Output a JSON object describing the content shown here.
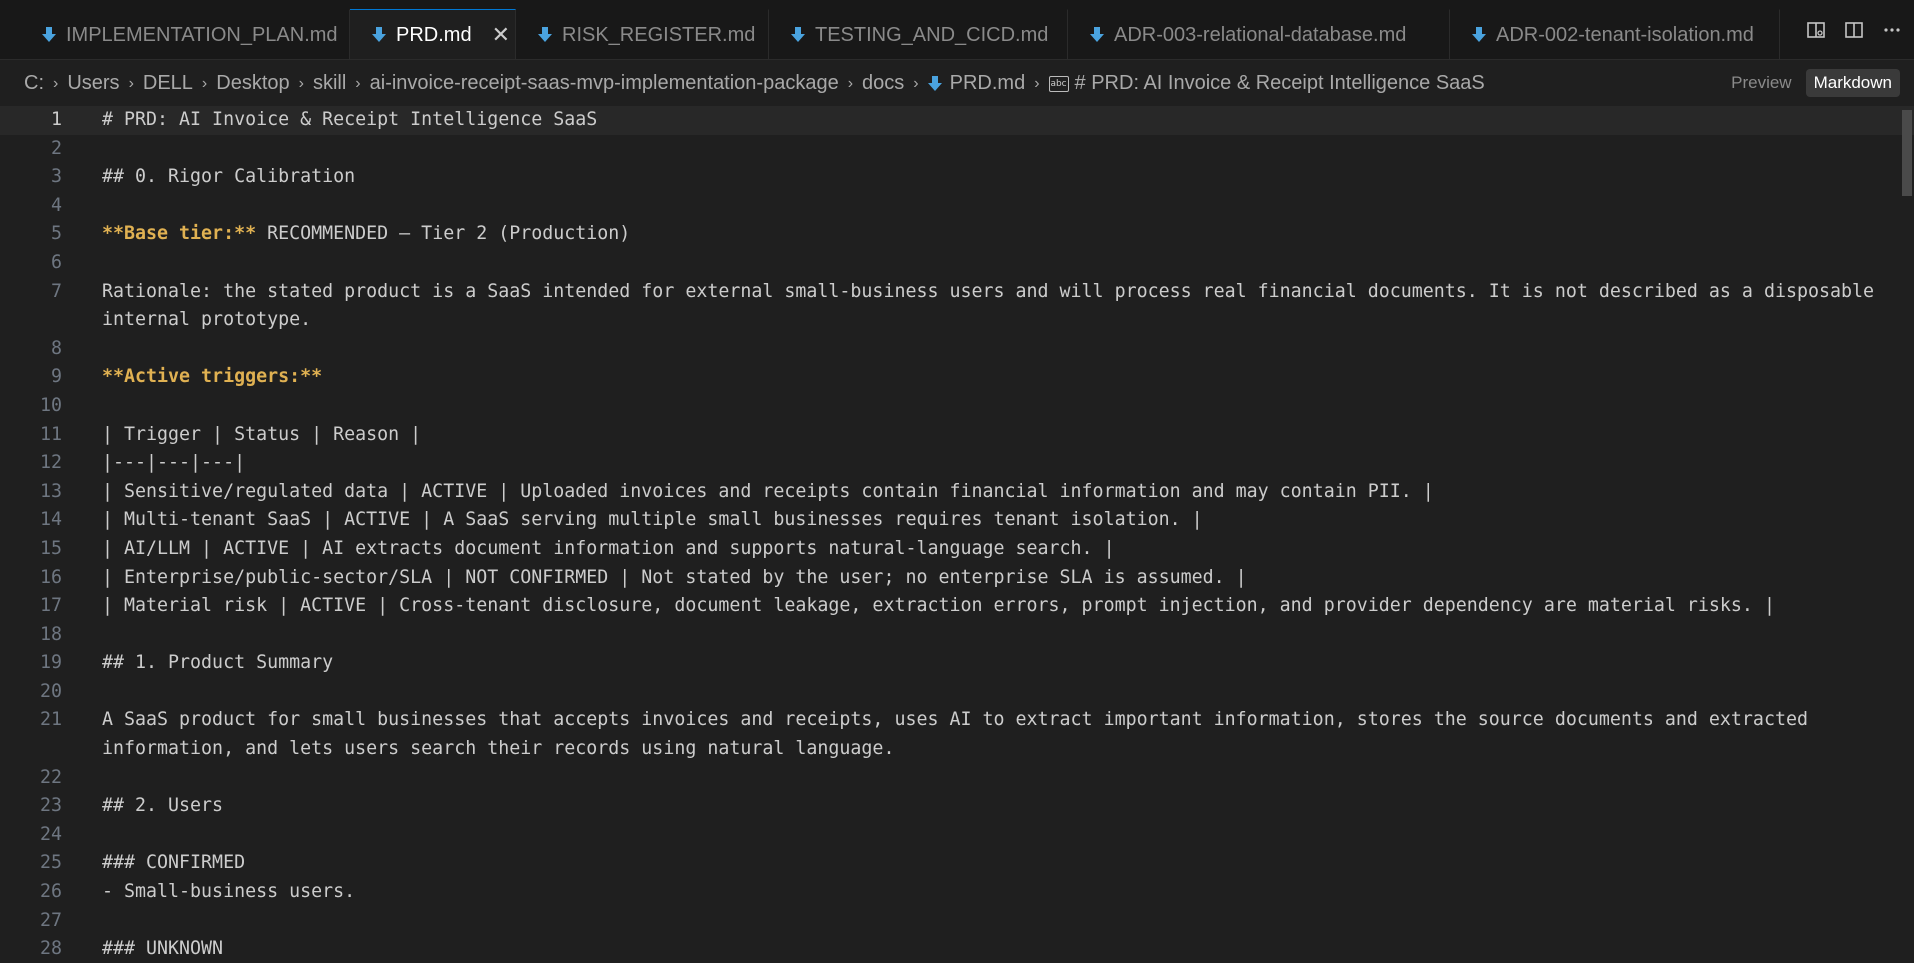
{
  "tabs": [
    {
      "label": "IMPLEMENTATION_PLAN.md",
      "active": false,
      "width": 330
    },
    {
      "label": "PRD.md",
      "active": true,
      "width": 166
    },
    {
      "label": "RISK_REGISTER.md",
      "active": false,
      "width": 253
    },
    {
      "label": "TESTING_AND_CICD.md",
      "active": false,
      "width": 299
    },
    {
      "label": "ADR-003-relational-database.md",
      "active": false,
      "width": 382
    },
    {
      "label": "ADR-002-tenant-isolation.md",
      "active": false,
      "width": 330
    }
  ],
  "breadcrumb": {
    "items": [
      "C:",
      "Users",
      "DELL",
      "Desktop",
      "skill",
      "ai-invoice-receipt-saas-mvp-implementation-package",
      "docs",
      "PRD.md"
    ],
    "symbol": "# PRD: AI Invoice & Receipt Intelligence SaaS"
  },
  "mode_toggle": {
    "preview": "Preview",
    "markdown": "Markdown"
  },
  "colors": {
    "accent": "#0078d4",
    "md_icon": "#4aa3df",
    "bold_text": "#e0b152"
  },
  "editor": {
    "current_line": 1,
    "lines": [
      {
        "n": "1",
        "parts": [
          {
            "t": "# PRD: AI Invoice & Receipt Intelligence SaaS"
          }
        ]
      },
      {
        "n": "2",
        "parts": []
      },
      {
        "n": "3",
        "parts": [
          {
            "t": "## 0. Rigor Calibration"
          }
        ]
      },
      {
        "n": "4",
        "parts": []
      },
      {
        "n": "5",
        "parts": [
          {
            "t": "**Base tier:**",
            "bold": true
          },
          {
            "t": " RECOMMENDED — Tier 2 (Production)"
          }
        ]
      },
      {
        "n": "6",
        "parts": []
      },
      {
        "n": "7",
        "parts": [
          {
            "t": "Rationale: the stated product is a SaaS intended for external small-business users and will process real financial documents. It is not described as a disposable internal prototype."
          }
        ],
        "wrap": true
      },
      {
        "n": "8",
        "parts": []
      },
      {
        "n": "9",
        "parts": [
          {
            "t": "**Active triggers:**",
            "bold": true
          }
        ]
      },
      {
        "n": "10",
        "parts": []
      },
      {
        "n": "11",
        "parts": [
          {
            "t": "| Trigger | Status | Reason |"
          }
        ]
      },
      {
        "n": "12",
        "parts": [
          {
            "t": "|---|---|---|"
          }
        ]
      },
      {
        "n": "13",
        "parts": [
          {
            "t": "| Sensitive/regulated data | ACTIVE | Uploaded invoices and receipts contain financial information and may contain PII. |"
          }
        ]
      },
      {
        "n": "14",
        "parts": [
          {
            "t": "| Multi-tenant SaaS | ACTIVE | A SaaS serving multiple small businesses requires tenant isolation. |"
          }
        ]
      },
      {
        "n": "15",
        "parts": [
          {
            "t": "| AI/LLM | ACTIVE | AI extracts document information and supports natural-language search. |"
          }
        ]
      },
      {
        "n": "16",
        "parts": [
          {
            "t": "| Enterprise/public-sector/SLA | NOT CONFIRMED | Not stated by the user; no enterprise SLA is assumed. |"
          }
        ]
      },
      {
        "n": "17",
        "parts": [
          {
            "t": "| Material risk | ACTIVE | Cross-tenant disclosure, document leakage, extraction errors, prompt injection, and provider dependency are material risks. |"
          }
        ]
      },
      {
        "n": "18",
        "parts": []
      },
      {
        "n": "19",
        "parts": [
          {
            "t": "## 1. Product Summary"
          }
        ]
      },
      {
        "n": "20",
        "parts": []
      },
      {
        "n": "21",
        "parts": [
          {
            "t": "A SaaS product for small businesses that accepts invoices and receipts, uses AI to extract important information, stores the source documents and extracted information, and lets users search their records using natural language."
          }
        ],
        "wrap": true
      },
      {
        "n": "22",
        "parts": []
      },
      {
        "n": "23",
        "parts": [
          {
            "t": "## 2. Users"
          }
        ]
      },
      {
        "n": "24",
        "parts": []
      },
      {
        "n": "25",
        "parts": [
          {
            "t": "### CONFIRMED"
          }
        ]
      },
      {
        "n": "26",
        "parts": [
          {
            "t": "- Small-business users."
          }
        ]
      },
      {
        "n": "27",
        "parts": []
      },
      {
        "n": "28",
        "parts": [
          {
            "t": "### UNKNOWN"
          }
        ]
      }
    ]
  }
}
